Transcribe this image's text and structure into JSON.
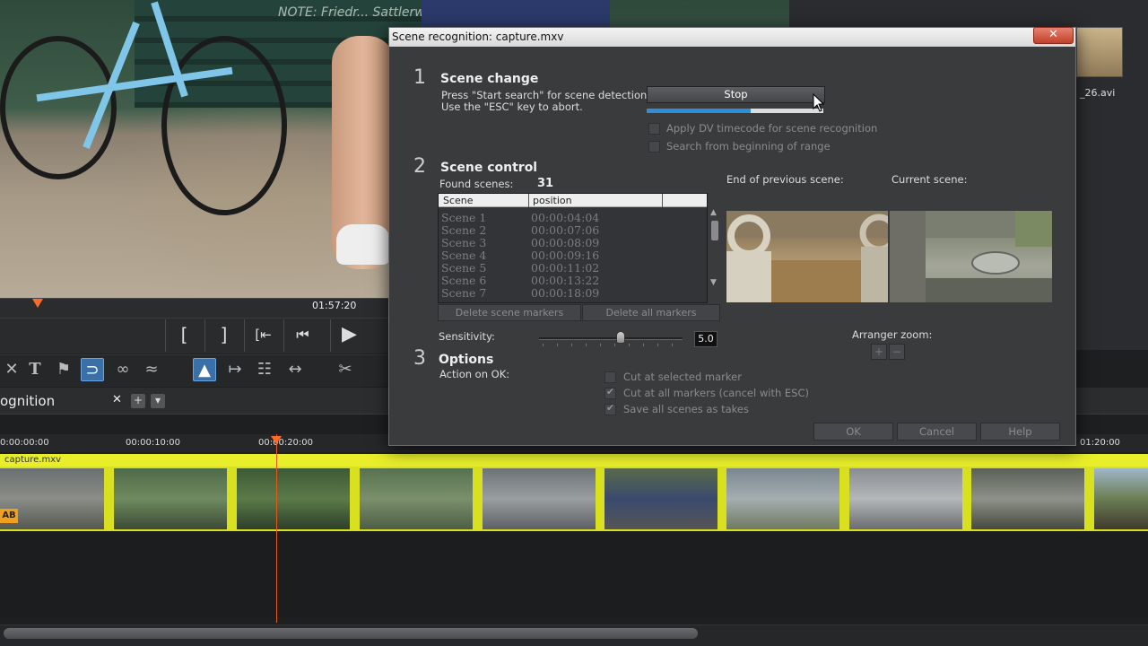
{
  "background": {
    "bench_text": "NOTE: Friedr... Sattlerwerke...",
    "ruler_time": "01:57:20",
    "transport": {
      "mark_in": "[",
      "mark_out": "]",
      "go_start": "[⇤",
      "prev": "⏮",
      "play": "▶"
    },
    "tab_label": "ognition",
    "tab_close": "✕",
    "tab_add": "+",
    "tab_menu": "▾",
    "timeline_times": [
      "0:00:00:00",
      "00:00:10:00",
      "00:00:20:00",
      "01:20:00"
    ],
    "track_name": "capture.mxv",
    "ab_badge": "AB",
    "media_label": "_26.avi"
  },
  "dialog": {
    "title": "Scene recognition: capture.mxv",
    "close_label": "✕",
    "section1": {
      "number": "1",
      "title": "Scene change",
      "line1": "Press \"Start search\" for scene detection.",
      "line2": "Use the \"ESC\" key to abort.",
      "stop_label": "Stop",
      "progress": 0.59,
      "opt_dv": "Apply DV timecode for scene recognition",
      "opt_begin": "Search from beginning of range"
    },
    "section2": {
      "number": "2",
      "title": "Scene control",
      "found_label": "Found scenes:",
      "found_count": "31",
      "col_scene": "Scene",
      "col_position": "position",
      "rows": [
        {
          "scene": "Scene 1",
          "position": "00:00:04:04"
        },
        {
          "scene": "Scene 2",
          "position": "00:00:07:06"
        },
        {
          "scene": "Scene 3",
          "position": "00:00:08:09"
        },
        {
          "scene": "Scene 4",
          "position": "00:00:09:16"
        },
        {
          "scene": "Scene 5",
          "position": "00:00:11:02"
        },
        {
          "scene": "Scene 6",
          "position": "00:00:13:22"
        },
        {
          "scene": "Scene 7",
          "position": "00:00:18:09"
        }
      ],
      "delete_scene_markers": "Delete scene markers",
      "delete_all_markers": "Delete all markers",
      "end_prev_label": "End of previous scene:",
      "current_label": "Current scene:"
    },
    "sensitivity": {
      "label": "Sensitivity:",
      "value": "5.0",
      "level": 0.57
    },
    "arranger_zoom": {
      "label": "Arranger zoom:",
      "plus": "+",
      "minus": "−"
    },
    "section3": {
      "number": "3",
      "title": "Options",
      "action_label": "Action on OK:",
      "opt_cut_selected": "Cut at selected marker",
      "opt_cut_all": "Cut at all markers (cancel with ESC)",
      "opt_save_takes": "Save all scenes as takes"
    },
    "buttons": {
      "ok": "OK",
      "cancel": "Cancel",
      "help": "Help"
    }
  },
  "colors": {
    "accent": "#2f8ed8",
    "track": "#e8ee2a",
    "playhead": "#ff6a2a"
  }
}
